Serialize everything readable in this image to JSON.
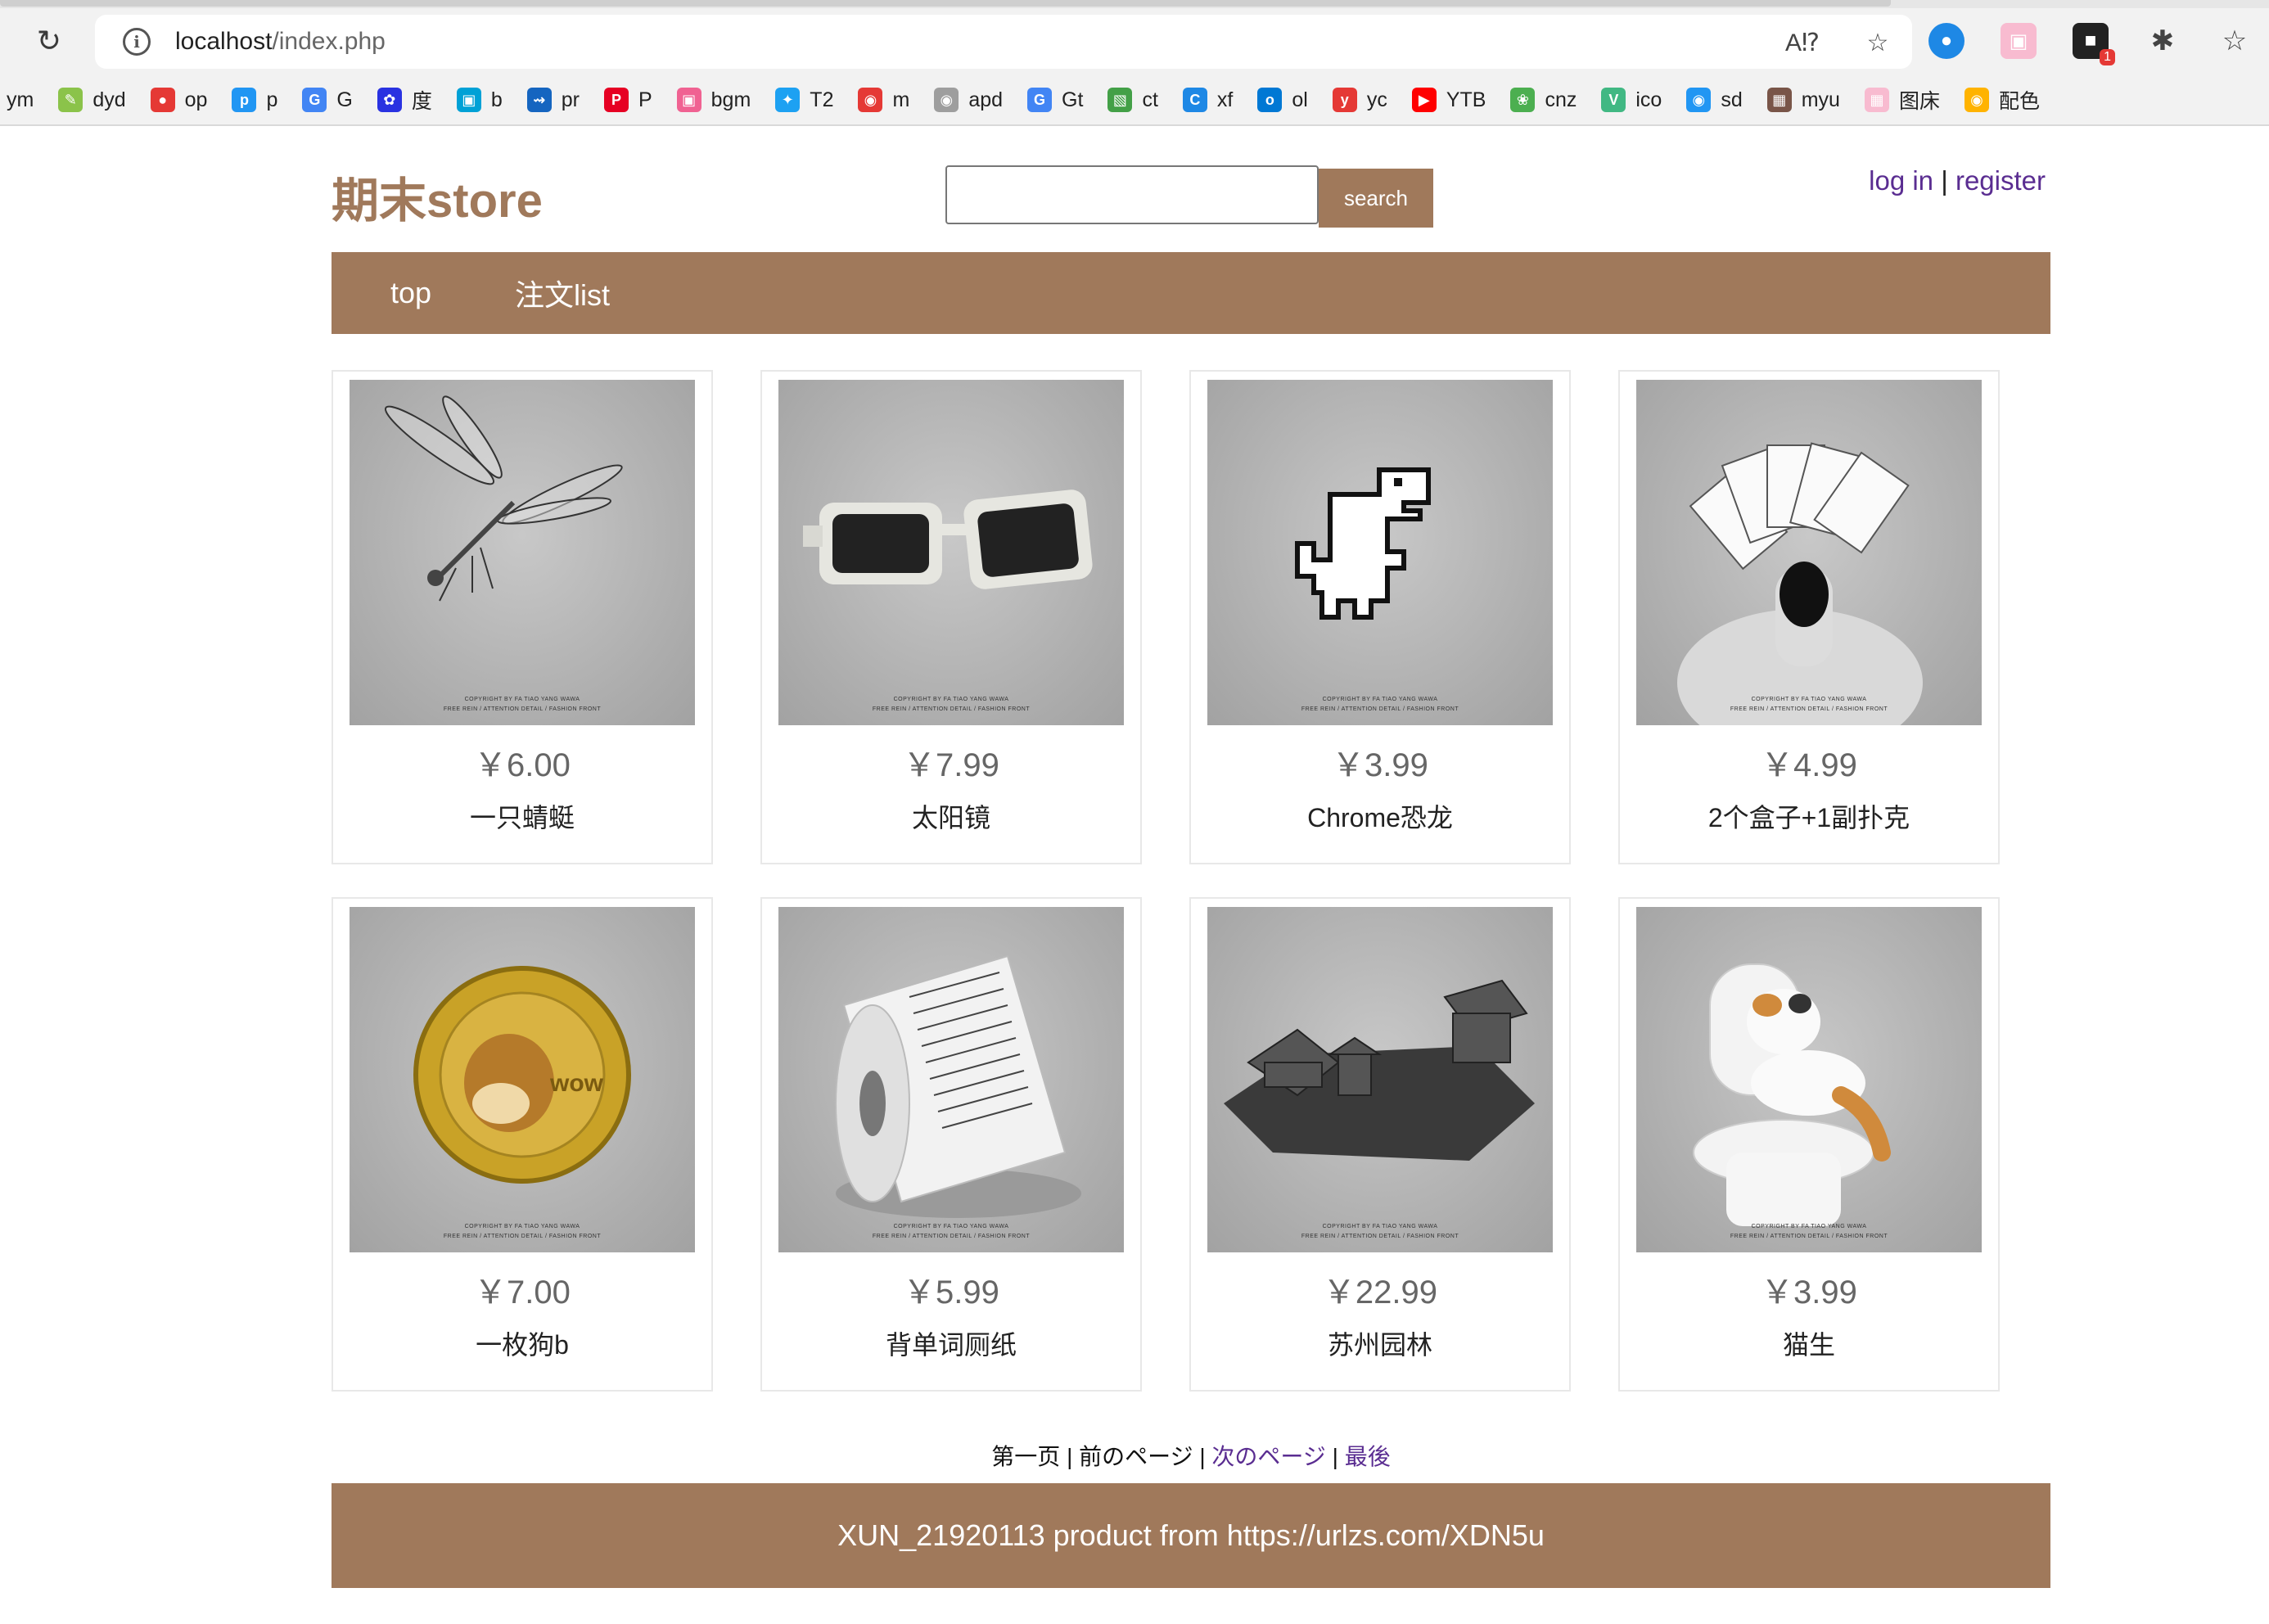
{
  "browser": {
    "url_host": "localhost",
    "url_path": "/index.php",
    "bookmarks": [
      {
        "label": "ym",
        "icon": "ym-icon",
        "color": "#ffffff"
      },
      {
        "label": "dyd",
        "icon": "pencil-icon",
        "color": "#8bc34a"
      },
      {
        "label": "op",
        "icon": "op-icon",
        "color": "#e53935"
      },
      {
        "label": "p",
        "icon": "p-icon",
        "color": "#2196f3"
      },
      {
        "label": "G",
        "icon": "google-icon",
        "color": "#4285f4"
      },
      {
        "label": "度",
        "icon": "baidu-icon",
        "color": "#2932e1"
      },
      {
        "label": "b",
        "icon": "bilibili-icon",
        "color": "#00a1d6"
      },
      {
        "label": "pr",
        "icon": "pr-icon",
        "color": "#1565c0"
      },
      {
        "label": "P",
        "icon": "pinterest-icon",
        "color": "#e60023"
      },
      {
        "label": "bgm",
        "icon": "bgm-icon",
        "color": "#f06292"
      },
      {
        "label": "T2",
        "icon": "twitter-icon",
        "color": "#1da1f2"
      },
      {
        "label": "m",
        "icon": "m-icon",
        "color": "#e53935"
      },
      {
        "label": "apd",
        "icon": "apd-icon",
        "color": "#9e9e9e"
      },
      {
        "label": "Gt",
        "icon": "translate-icon",
        "color": "#4285f4"
      },
      {
        "label": "ct",
        "icon": "ct-icon",
        "color": "#43a047"
      },
      {
        "label": "xf",
        "icon": "xf-icon",
        "color": "#1e88e5"
      },
      {
        "label": "ol",
        "icon": "outlook-icon",
        "color": "#0078d4"
      },
      {
        "label": "yc",
        "icon": "yc-icon",
        "color": "#e53935"
      },
      {
        "label": "YTB",
        "icon": "youtube-icon",
        "color": "#ff0000"
      },
      {
        "label": "cnz",
        "icon": "cnz-icon",
        "color": "#4caf50"
      },
      {
        "label": "ico",
        "icon": "vue-icon",
        "color": "#41b883"
      },
      {
        "label": "sd",
        "icon": "sd-icon",
        "color": "#2196f3"
      },
      {
        "label": "myu",
        "icon": "myu-icon",
        "color": "#795548"
      },
      {
        "label": "图床",
        "icon": "tuchuang-icon",
        "color": "#f8bbd0"
      },
      {
        "label": "配色",
        "icon": "peise-icon",
        "color": "#ffb300"
      }
    ]
  },
  "site": {
    "logo": "期末store",
    "search_placeholder": "",
    "search_label": "search",
    "login_label": "log in",
    "separator": "|",
    "register_label": "register",
    "nav": [
      {
        "label": "top"
      },
      {
        "label": "注文list"
      }
    ]
  },
  "products": [
    {
      "price": "￥6.00",
      "name": "一只蜻蜓",
      "image": "dragonfly"
    },
    {
      "price": "￥7.99",
      "name": "太阳镜",
      "image": "sunglasses"
    },
    {
      "price": "￥3.99",
      "name": "Chrome恐龙",
      "image": "dino-pin"
    },
    {
      "price": "￥4.99",
      "name": "2个盒子+1副扑克",
      "image": "playing-cards"
    },
    {
      "price": "￥7.00",
      "name": "一枚狗b",
      "image": "doge-coin"
    },
    {
      "price": "￥5.99",
      "name": "背单词厕纸",
      "image": "toilet-paper"
    },
    {
      "price": "￥22.99",
      "name": "苏州园林",
      "image": "garden-model"
    },
    {
      "price": "￥3.99",
      "name": "猫生",
      "image": "cat-figurine"
    }
  ],
  "image_caption": {
    "line1": "COPYRIGHT BY FA TIAO YANG WAWA",
    "line2": "FREE REIN / ATTENTION DETAIL / FASHION FRONT"
  },
  "pagination": {
    "first": "第一页",
    "prev": "前のページ",
    "next": "次のページ",
    "last": "最後",
    "sep": "|"
  },
  "footer": {
    "text": "XUN_21920113 product from https://urlzs.com/XDN5u"
  },
  "theme": {
    "accent": "#a0795b",
    "link": "#5a2d91"
  }
}
